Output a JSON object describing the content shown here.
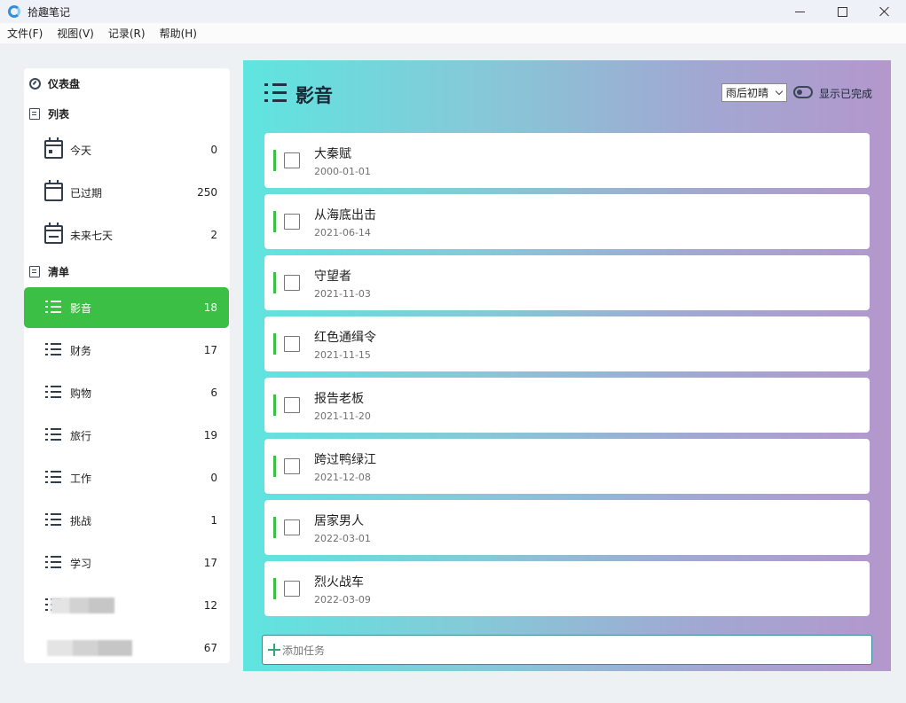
{
  "window": {
    "title": "拾趣笔记",
    "controls": [
      "minimize-icon",
      "maximize-icon",
      "close-icon"
    ]
  },
  "menu": [
    {
      "label": "文件(F)"
    },
    {
      "label": "视图(V)"
    },
    {
      "label": "记录(R)"
    },
    {
      "label": "帮助(H)"
    }
  ],
  "sidebar": {
    "dashboard_label": "仪表盘",
    "lists_label": "列表",
    "smart_lists": [
      {
        "label": "今天",
        "count": "0",
        "icon": "calendar-today-icon"
      },
      {
        "label": "已过期",
        "count": "250",
        "icon": "calendar-icon"
      },
      {
        "label": "未来七天",
        "count": "2",
        "icon": "calendar-week-icon"
      }
    ],
    "checklists_label": "清单",
    "checklists": [
      {
        "label": "影音",
        "count": "18",
        "active": true
      },
      {
        "label": "财务",
        "count": "17"
      },
      {
        "label": "购物",
        "count": "6"
      },
      {
        "label": "旅行",
        "count": "19"
      },
      {
        "label": "工作",
        "count": "0"
      },
      {
        "label": "挑战",
        "count": "1"
      },
      {
        "label": "学习",
        "count": "17"
      },
      {
        "label": "",
        "count": "12"
      },
      {
        "label": "",
        "count": "67"
      }
    ]
  },
  "main": {
    "title": "影音",
    "weather_selected": "雨后初晴",
    "toggle_label": "显示已完成",
    "tasks": [
      {
        "title": "大秦赋",
        "date": "2000-01-01"
      },
      {
        "title": "从海底出击",
        "date": "2021-06-14"
      },
      {
        "title": "守望者",
        "date": "2021-11-03"
      },
      {
        "title": "红色通缉令",
        "date": "2021-11-15"
      },
      {
        "title": "报告老板",
        "date": "2021-11-20"
      },
      {
        "title": "跨过鸭绿江",
        "date": "2021-12-08"
      },
      {
        "title": "居家男人",
        "date": "2022-03-01"
      },
      {
        "title": "烈火战车",
        "date": "2022-03-09"
      }
    ],
    "add_placeholder": "添加任务"
  },
  "colors": {
    "accent": "#3bbf45",
    "gradient_start": "#5ee5e0",
    "gradient_end": "#b497cc"
  }
}
